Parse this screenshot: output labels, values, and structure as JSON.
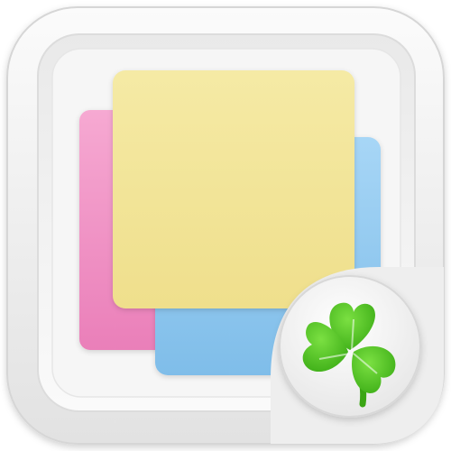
{
  "icon": {
    "kind": "app-icon",
    "subject": "stacked-sticky-notes",
    "badge": "four-leaf-clover-icon"
  },
  "colors": {
    "frame_outer": "#eeeeee",
    "frame_inner": "#f7f7f7",
    "note_pink": "#f08fc2",
    "note_blue": "#8fc8ef",
    "note_yellow": "#f2e49a",
    "badge_bg": "#f5f5f5",
    "clover_green": "#4cc21c"
  }
}
